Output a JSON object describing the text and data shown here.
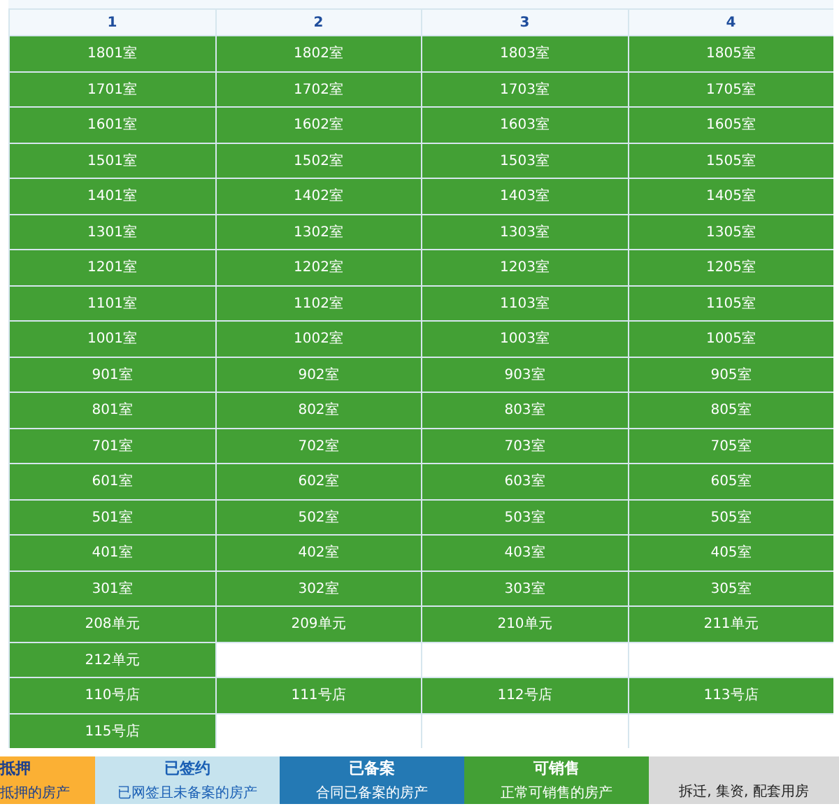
{
  "table": {
    "columns": [
      "1",
      "2",
      "3",
      "4"
    ],
    "rows": [
      [
        {
          "label": "1801室",
          "kind": "for_sale"
        },
        {
          "label": "1802室",
          "kind": "for_sale"
        },
        {
          "label": "1803室",
          "kind": "for_sale"
        },
        {
          "label": "1805室",
          "kind": "for_sale"
        }
      ],
      [
        {
          "label": "1701室",
          "kind": "for_sale"
        },
        {
          "label": "1702室",
          "kind": "for_sale"
        },
        {
          "label": "1703室",
          "kind": "for_sale"
        },
        {
          "label": "1705室",
          "kind": "for_sale"
        }
      ],
      [
        {
          "label": "1601室",
          "kind": "for_sale"
        },
        {
          "label": "1602室",
          "kind": "for_sale"
        },
        {
          "label": "1603室",
          "kind": "for_sale"
        },
        {
          "label": "1605室",
          "kind": "for_sale"
        }
      ],
      [
        {
          "label": "1501室",
          "kind": "for_sale"
        },
        {
          "label": "1502室",
          "kind": "for_sale"
        },
        {
          "label": "1503室",
          "kind": "for_sale"
        },
        {
          "label": "1505室",
          "kind": "for_sale"
        }
      ],
      [
        {
          "label": "1401室",
          "kind": "for_sale"
        },
        {
          "label": "1402室",
          "kind": "for_sale"
        },
        {
          "label": "1403室",
          "kind": "for_sale"
        },
        {
          "label": "1405室",
          "kind": "for_sale"
        }
      ],
      [
        {
          "label": "1301室",
          "kind": "for_sale"
        },
        {
          "label": "1302室",
          "kind": "for_sale"
        },
        {
          "label": "1303室",
          "kind": "for_sale"
        },
        {
          "label": "1305室",
          "kind": "for_sale"
        }
      ],
      [
        {
          "label": "1201室",
          "kind": "for_sale"
        },
        {
          "label": "1202室",
          "kind": "for_sale"
        },
        {
          "label": "1203室",
          "kind": "for_sale"
        },
        {
          "label": "1205室",
          "kind": "for_sale"
        }
      ],
      [
        {
          "label": "1101室",
          "kind": "for_sale"
        },
        {
          "label": "1102室",
          "kind": "for_sale"
        },
        {
          "label": "1103室",
          "kind": "for_sale"
        },
        {
          "label": "1105室",
          "kind": "for_sale"
        }
      ],
      [
        {
          "label": "1001室",
          "kind": "for_sale"
        },
        {
          "label": "1002室",
          "kind": "for_sale"
        },
        {
          "label": "1003室",
          "kind": "for_sale"
        },
        {
          "label": "1005室",
          "kind": "for_sale"
        }
      ],
      [
        {
          "label": "901室",
          "kind": "for_sale"
        },
        {
          "label": "902室",
          "kind": "for_sale"
        },
        {
          "label": "903室",
          "kind": "for_sale"
        },
        {
          "label": "905室",
          "kind": "for_sale"
        }
      ],
      [
        {
          "label": "801室",
          "kind": "for_sale"
        },
        {
          "label": "802室",
          "kind": "for_sale"
        },
        {
          "label": "803室",
          "kind": "for_sale"
        },
        {
          "label": "805室",
          "kind": "for_sale"
        }
      ],
      [
        {
          "label": "701室",
          "kind": "for_sale"
        },
        {
          "label": "702室",
          "kind": "for_sale"
        },
        {
          "label": "703室",
          "kind": "for_sale"
        },
        {
          "label": "705室",
          "kind": "for_sale"
        }
      ],
      [
        {
          "label": "601室",
          "kind": "for_sale"
        },
        {
          "label": "602室",
          "kind": "for_sale"
        },
        {
          "label": "603室",
          "kind": "for_sale"
        },
        {
          "label": "605室",
          "kind": "for_sale"
        }
      ],
      [
        {
          "label": "501室",
          "kind": "for_sale"
        },
        {
          "label": "502室",
          "kind": "for_sale"
        },
        {
          "label": "503室",
          "kind": "for_sale"
        },
        {
          "label": "505室",
          "kind": "for_sale"
        }
      ],
      [
        {
          "label": "401室",
          "kind": "for_sale"
        },
        {
          "label": "402室",
          "kind": "for_sale"
        },
        {
          "label": "403室",
          "kind": "for_sale"
        },
        {
          "label": "405室",
          "kind": "for_sale"
        }
      ],
      [
        {
          "label": "301室",
          "kind": "for_sale"
        },
        {
          "label": "302室",
          "kind": "for_sale"
        },
        {
          "label": "303室",
          "kind": "for_sale"
        },
        {
          "label": "305室",
          "kind": "for_sale"
        }
      ],
      [
        {
          "label": "208单元",
          "kind": "for_sale"
        },
        {
          "label": "209单元",
          "kind": "for_sale"
        },
        {
          "label": "210单元",
          "kind": "for_sale"
        },
        {
          "label": "211单元",
          "kind": "for_sale"
        }
      ],
      [
        {
          "label": "212单元",
          "kind": "for_sale"
        }
      ],
      [
        {
          "label": "110号店",
          "kind": "for_sale"
        },
        {
          "label": "111号店",
          "kind": "for_sale"
        },
        {
          "label": "112号店",
          "kind": "for_sale"
        },
        {
          "label": "113号店",
          "kind": "for_sale"
        }
      ],
      [
        {
          "label": "115号店",
          "kind": "for_sale"
        }
      ]
    ]
  },
  "legend": [
    {
      "kind": "mortgaged",
      "color": "#fbb034",
      "title": "抵押",
      "description": "抵押的房产"
    },
    {
      "kind": "signed",
      "color": "#c6e3ee",
      "title": "已签约",
      "description": "已网签且未备案的房产"
    },
    {
      "kind": "filed",
      "color": "#2479b4",
      "title": "已备案",
      "description": "合同已备案的房产"
    },
    {
      "kind": "for_sale",
      "color": "#43a035",
      "title": "可销售",
      "description": "正常可销售的房产"
    },
    {
      "kind": "other",
      "color": "#d9d9d9",
      "description": "拆迁, 集资, 配套用房"
    }
  ]
}
